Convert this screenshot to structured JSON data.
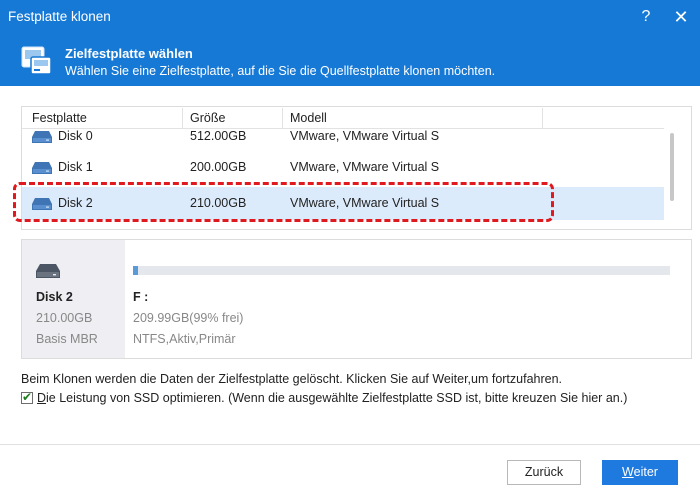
{
  "window": {
    "title": "Festplatte klonen",
    "help_glyph": "?",
    "close_glyph": "✕"
  },
  "header": {
    "icon": "disk-stack-icon",
    "title": "Zielfestplatte wählen",
    "subtitle": "Wählen Sie eine Zielfestplatte, auf die Sie die Quellfestplatte klonen möchten."
  },
  "table": {
    "columns": [
      "Festplatte",
      "Größe",
      "Modell"
    ],
    "rows": [
      {
        "name": "Disk 0",
        "size": "512.00GB",
        "model": "VMware, VMware Virtual S",
        "icon": "hard-drive-icon"
      },
      {
        "name": "Disk 1",
        "size": "200.00GB",
        "model": "VMware, VMware Virtual S",
        "icon": "hard-drive-icon"
      },
      {
        "name": "Disk 2",
        "size": "210.00GB",
        "model": "VMware, VMware Virtual S",
        "icon": "hard-drive-icon",
        "selected": true
      }
    ]
  },
  "details": {
    "icon": "hard-drive-icon",
    "disk_name": "Disk 2",
    "disk_size": "210.00GB",
    "disk_type": "Basis MBR",
    "partition": {
      "label": "F :",
      "free": "209.99GB(99% frei)",
      "fs": "NTFS,Aktiv,Primär",
      "used_fraction": 0.01
    }
  },
  "warning": "Beim Klonen werden die Daten der Zielfestplatte gelöscht. Klicken Sie auf Weiter,um fortzufahren.",
  "ssd_option": {
    "checked": true,
    "label_underlined": "D",
    "label_rest": "ie Leistung von SSD optimieren. (Wenn die ausgewählte Zielfestplatte SSD ist, bitte kreuzen Sie hier an.)"
  },
  "buttons": {
    "back": "Zurück",
    "next_underlined": "W",
    "next_rest": "eiter"
  },
  "colors": {
    "accent": "#1779d6",
    "selection": "#dcebfb",
    "highlight": "#e0191f",
    "primary_button": "#1f7ae0"
  }
}
